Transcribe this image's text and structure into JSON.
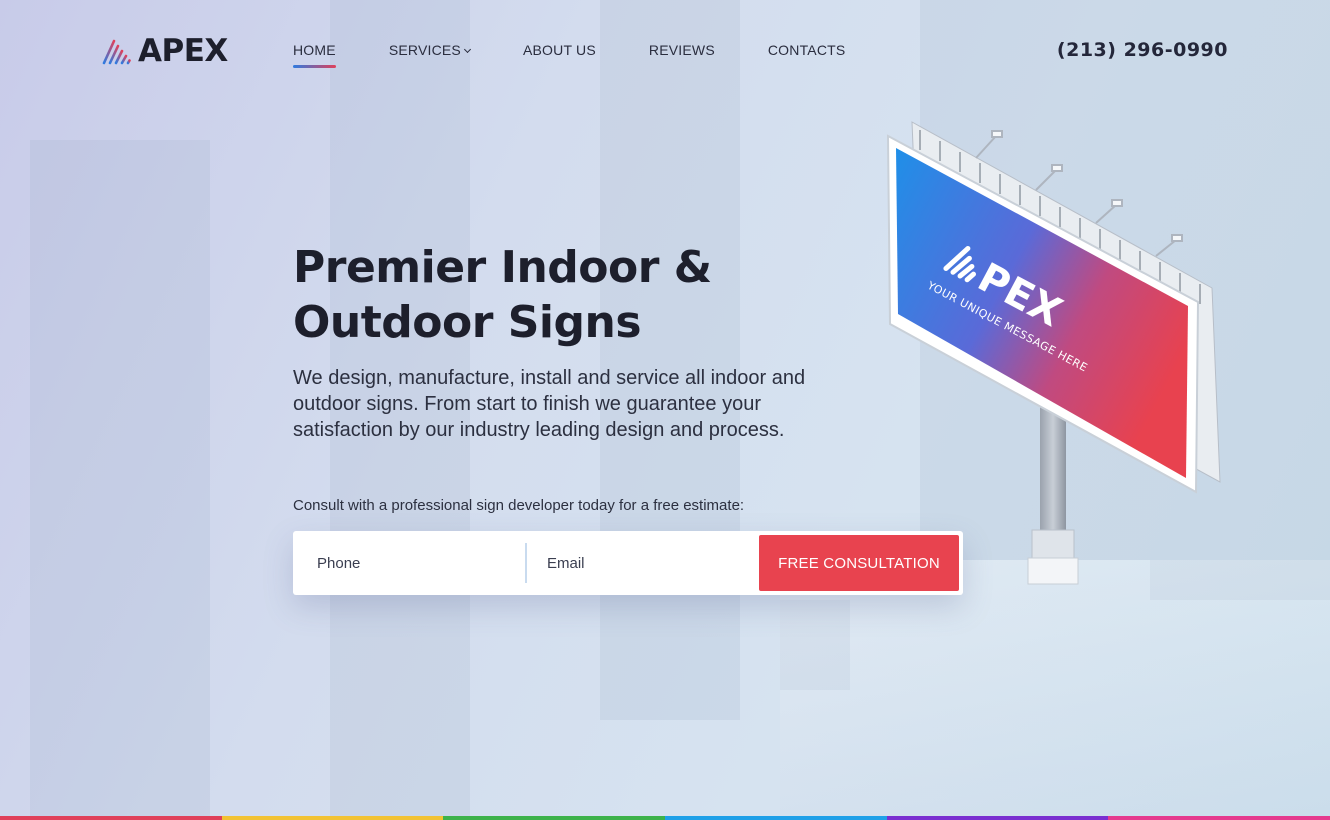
{
  "brand": {
    "name": "APEX"
  },
  "nav": {
    "items": [
      {
        "label": "HOME",
        "active": true
      },
      {
        "label": "SERVICES",
        "has_dropdown": true
      },
      {
        "label": "ABOUT US"
      },
      {
        "label": "REVIEWS"
      },
      {
        "label": "CONTACTS"
      }
    ]
  },
  "header": {
    "phone": "(213) 296-0990"
  },
  "hero": {
    "title_line1": "Premier Indoor &",
    "title_line2": "Outdoor Signs",
    "description": "We design, manufacture, install and service all indoor and outdoor signs. From start to finish we guarantee your satisfaction by our industry leading design and process.",
    "cta_label": "Consult with a professional sign developer today for a free estimate:"
  },
  "form": {
    "phone_placeholder": "Phone",
    "email_placeholder": "Email",
    "submit_label": "FREE CONSULTATION"
  },
  "billboard": {
    "brand_text": "PEX",
    "tagline": "YOUR UNIQUE MESSAGE HERE"
  },
  "colors": {
    "accent": "#e8434f",
    "nav_underline": [
      "#2f7be0",
      "#e0405a"
    ],
    "bottom_bar": [
      "#e0405a",
      "#f2c233",
      "#3db24a",
      "#1fa0e8",
      "#7a2fd0",
      "#e53a8e"
    ]
  },
  "icons": {
    "logo_mark": "apex-stripes-logo-icon",
    "dropdown": "chevron-down-icon"
  }
}
